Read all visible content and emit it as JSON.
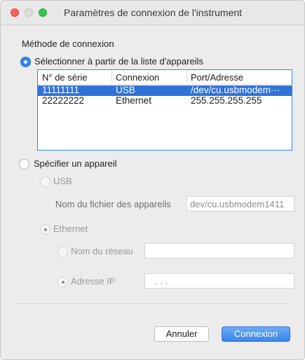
{
  "window": {
    "title": "Paramètres de connexion de l'instrument"
  },
  "method": {
    "label": "Méthode de connexion",
    "option_list": "Sélectionner à partir de la liste d'appareils",
    "option_specify": "Spécifier un appareil"
  },
  "table": {
    "columns": [
      "N° de série",
      "Connexion",
      "Port/Adresse"
    ],
    "rows": [
      {
        "serial": "11111111",
        "connection": "USB",
        "port": "/dev/cu.usbmodem···",
        "selected": true
      },
      {
        "serial": "22222222",
        "connection": "Ethernet",
        "port": "255.255.255.255",
        "selected": false
      }
    ]
  },
  "specify": {
    "usb_label": "USB",
    "device_file_label": "Nom du fichier des appareils",
    "device_file_value": "dev/cu.usbmodem1411",
    "ethernet_label": "Ethernet",
    "network_name_label": "Nom du réseau",
    "network_name_value": "",
    "ip_label": "Adresse IP",
    "ip_value": ".       .       ."
  },
  "buttons": {
    "cancel": "Annuler",
    "ok": "Connexion"
  },
  "colors": {
    "accent": "#2f86f6",
    "selection": "#2f73d9"
  }
}
